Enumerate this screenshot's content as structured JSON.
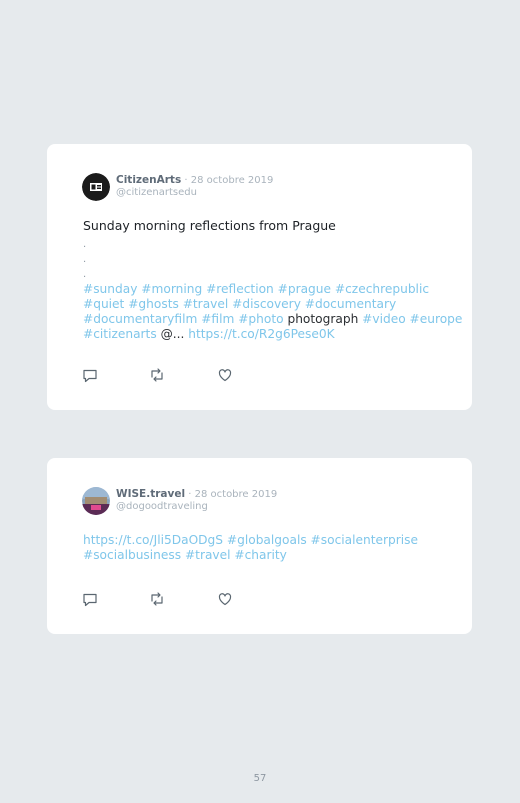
{
  "tweets": [
    {
      "author": "CitizenArts",
      "separator": "·",
      "date": "28 octobre 2019",
      "handle": "@citizenartsedu",
      "lead": "Sunday morning reflections from Prague",
      "dots": [
        ".",
        ".",
        "."
      ],
      "lines": [
        [
          {
            "t": "#sunday #morning #reflection #prague #czechrepublic",
            "k": "tag"
          }
        ],
        [
          {
            "t": "#quiet #ghosts #travel #discovery #documentary",
            "k": "tag"
          }
        ],
        [
          {
            "t": "#documentaryfilm #film #photo ",
            "k": "tag"
          },
          {
            "t": "photograph",
            "k": "plain"
          },
          {
            "t": " #video #europe",
            "k": "tag"
          }
        ],
        [
          {
            "t": "#citizenarts ",
            "k": "tag"
          },
          {
            "t": "@... ",
            "k": "plain"
          },
          {
            "t": " https://t.co/R2g6Pese0K",
            "k": "tag"
          }
        ]
      ],
      "icons": [
        "reply-icon",
        "retweet-icon",
        "like-icon"
      ]
    },
    {
      "author": "WISE.travel",
      "separator": "·",
      "date": "28 octobre 2019",
      "handle": "@dogoodtraveling",
      "lines": [
        [
          {
            "t": "https://t.co/Jli5DaODgS #globalgoals #socialenterprise",
            "k": "tag"
          }
        ],
        [
          {
            "t": "#socialbusiness #travel #charity",
            "k": "tag"
          }
        ]
      ],
      "icons": [
        "reply-icon",
        "retweet-icon",
        "like-icon"
      ]
    }
  ],
  "page_number": "57",
  "colors": {
    "background": "#e6eaed",
    "card": "#ffffff",
    "link": "#7fc6ea",
    "muted": "#a9b3bc"
  }
}
